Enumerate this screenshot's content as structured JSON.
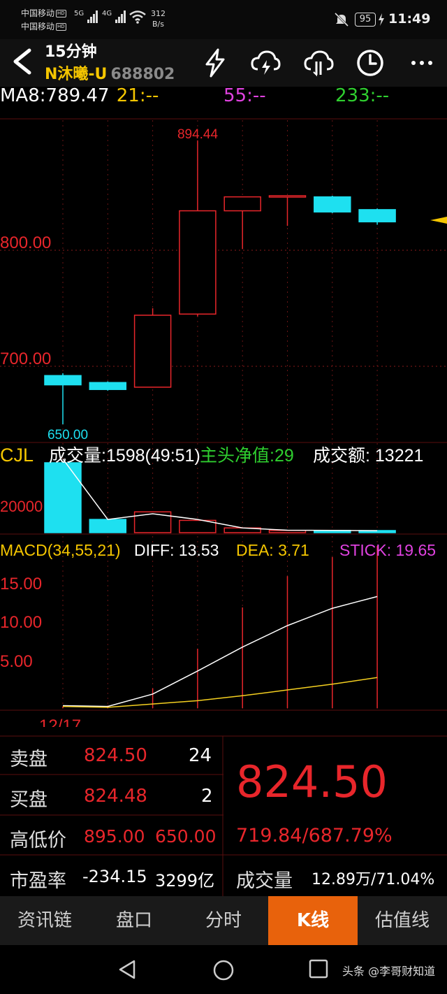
{
  "status_bar": {
    "carrier1": "中国移动",
    "carrier2": "中国移动",
    "hd": "HD",
    "net1": "5G",
    "net2": "4G",
    "speed_value": "312",
    "speed_unit": "B/s",
    "battery": "95",
    "time": "11:49"
  },
  "header": {
    "period": "15分钟",
    "stock_name": "N沐曦-U",
    "stock_code": "688802",
    "icons": [
      "back-arrow-icon",
      "lightning-icon",
      "cloud-lightning-icon",
      "cloud-split-icon",
      "clock-icon",
      "more-icon"
    ]
  },
  "ma_row": {
    "ma8": "MA8:789.47",
    "ma21": "21:--",
    "ma55": "55:--",
    "ma233": "233:--"
  },
  "kline": {
    "high_label": "894.44",
    "low_label": "650.00",
    "axis_800": "800.00",
    "axis_700": "700.00"
  },
  "volume": {
    "cjl": "CJL",
    "volume_text": "成交量:1598(49:51)",
    "net_text": "主头净值:29",
    "amount_text": "成交额: 13221",
    "axis_20000": "20000"
  },
  "macd": {
    "title": "MACD(34,55,21)",
    "diff": "DIFF: 13.53",
    "dea": "DEA: 3.71",
    "stick": "STICK: 19.65",
    "axis_15": "15.00",
    "axis_10": "10.00",
    "axis_5": "5.00",
    "date": "12/17"
  },
  "chart_data": {
    "type": "candlestick",
    "candles": [
      {
        "open": 692,
        "close": 684,
        "high": 694,
        "low": 650
      },
      {
        "open": 686,
        "close": 680,
        "high": 687,
        "low": 679
      },
      {
        "open": 682,
        "close": 744,
        "high": 750,
        "low": 682
      },
      {
        "open": 745,
        "close": 834,
        "high": 894.44,
        "low": 743
      },
      {
        "open": 834,
        "close": 846,
        "high": 846,
        "low": 801
      },
      {
        "open": 847,
        "close": 847,
        "high": 847,
        "low": 821
      },
      {
        "open": 846,
        "close": 833,
        "high": 847,
        "low": 832
      },
      {
        "open": 835,
        "close": 824.5,
        "high": 836,
        "low": 822
      }
    ],
    "volume": [
      3700,
      700,
      1100,
      650,
      250,
      120,
      120,
      100
    ],
    "volume_line": [
      3900,
      700,
      1000,
      700,
      250,
      130,
      120,
      100
    ],
    "macd_diff": [
      0.3,
      0.2,
      1.7,
      4.5,
      7.4,
      10.0,
      12.1,
      13.53
    ],
    "macd_dea": [
      0.2,
      0.1,
      0.5,
      0.9,
      1.5,
      2.2,
      2.9,
      3.71
    ],
    "macd_stick": [
      0.2,
      0.3,
      2.4,
      7.2,
      12.2,
      16.0,
      18.3,
      19.65
    ],
    "price_axis": [
      700,
      800
    ],
    "macd_axis": [
      5,
      10,
      15
    ]
  },
  "quote": {
    "sell_label": "卖盘",
    "sell_price": "824.50",
    "sell_qty": "24",
    "buy_label": "买盘",
    "buy_price": "824.48",
    "buy_qty": "2",
    "hl_label": "高低价",
    "high": "895.00",
    "low": "650.00",
    "pe_label": "市盈率",
    "pe": "-234.15",
    "mcap": "3299亿",
    "last_price": "824.50",
    "change": "719.84/687.79%",
    "vol_label": "成交量",
    "vol_value": "12.89万/71.04%"
  },
  "tabs": [
    {
      "label": "资讯链",
      "active": false
    },
    {
      "label": "盘口",
      "active": false
    },
    {
      "label": "分时",
      "active": false
    },
    {
      "label": "K线",
      "active": true
    },
    {
      "label": "估值线",
      "active": false
    }
  ],
  "nav": {
    "watermark": "头条 @李哥财知道"
  }
}
